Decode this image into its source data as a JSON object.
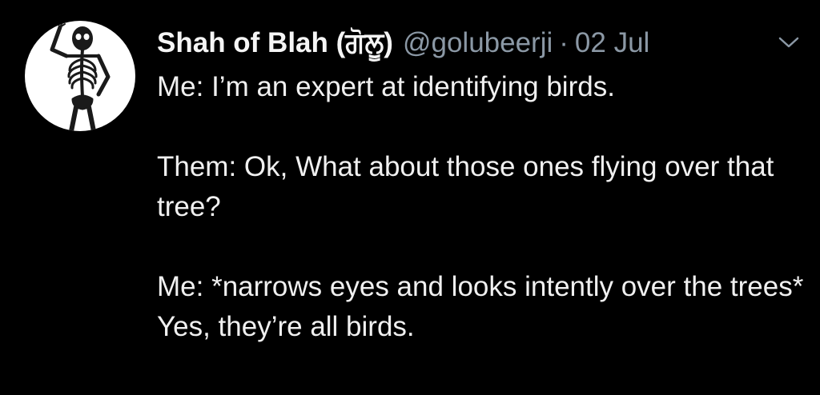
{
  "tweet": {
    "author": {
      "display_name": "Shah of Blah (ਗੋਲੂ)",
      "handle": "@golubeerji",
      "avatar_icon": "skeleton-icon"
    },
    "separator": "·",
    "date": "02 Jul",
    "menu_icon": "chevron-down-icon",
    "paragraphs": [
      "Me: I’m an expert at identifying birds.",
      "Them: Ok, What about those ones flying over that tree?",
      "Me: *narrows eyes and looks intently over the trees* Yes, they’re all birds."
    ]
  },
  "colors": {
    "background": "#000000",
    "text": "#f0f0f0",
    "secondary_text": "#8b98a5"
  }
}
